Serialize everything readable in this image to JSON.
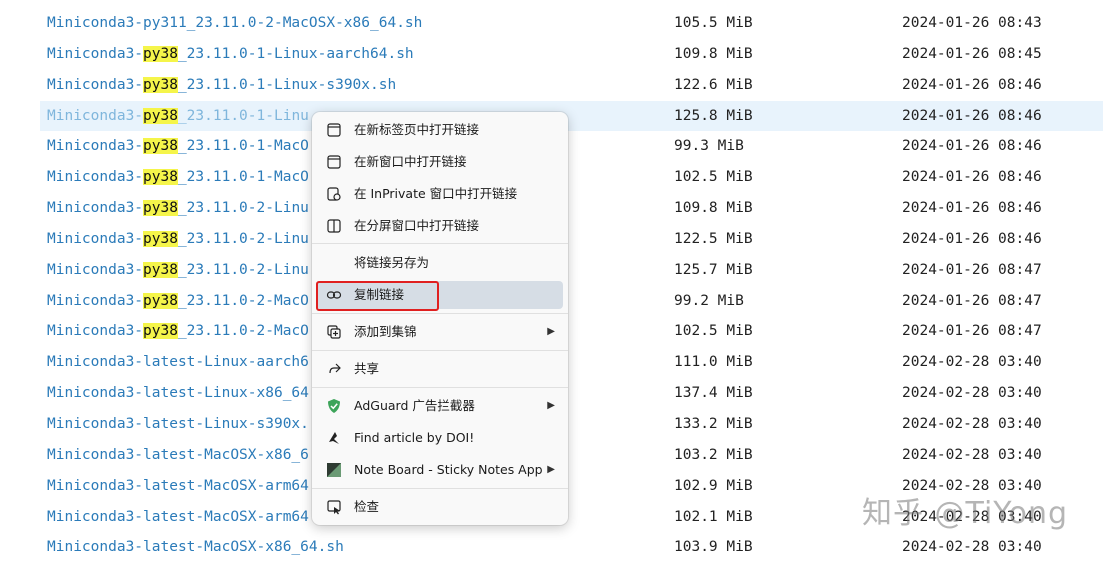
{
  "files": [
    {
      "pre": "Miniconda3-py311_23.11.0-2-MacOSX-x86_64.sh",
      "hl": "",
      "post": "",
      "size": "105.5 MiB",
      "date": "2024-01-26 08:43"
    },
    {
      "pre": "Miniconda3-",
      "hl": "py38",
      "post": "_23.11.0-1-Linux-aarch64.sh",
      "size": "109.8 MiB",
      "date": "2024-01-26 08:45"
    },
    {
      "pre": "Miniconda3-",
      "hl": "py38",
      "post": "_23.11.0-1-Linux-s390x.sh",
      "size": "122.6 MiB",
      "date": "2024-01-26 08:46"
    },
    {
      "pre": "Miniconda3-",
      "hl": "py38",
      "post": "_23.11.0-1-Linu",
      "size": "125.8 MiB",
      "date": "2024-01-26 08:46"
    },
    {
      "pre": "Miniconda3-",
      "hl": "py38",
      "post": "_23.11.0-1-MacO",
      "size": "99.3 MiB",
      "date": "2024-01-26 08:46"
    },
    {
      "pre": "Miniconda3-",
      "hl": "py38",
      "post": "_23.11.0-1-MacO",
      "size": "102.5 MiB",
      "date": "2024-01-26 08:46"
    },
    {
      "pre": "Miniconda3-",
      "hl": "py38",
      "post": "_23.11.0-2-Linu",
      "size": "109.8 MiB",
      "date": "2024-01-26 08:46"
    },
    {
      "pre": "Miniconda3-",
      "hl": "py38",
      "post": "_23.11.0-2-Linu",
      "size": "122.5 MiB",
      "date": "2024-01-26 08:46"
    },
    {
      "pre": "Miniconda3-",
      "hl": "py38",
      "post": "_23.11.0-2-Linu",
      "size": "125.7 MiB",
      "date": "2024-01-26 08:47"
    },
    {
      "pre": "Miniconda3-",
      "hl": "py38",
      "post": "_23.11.0-2-MacO",
      "size": "99.2 MiB",
      "date": "2024-01-26 08:47"
    },
    {
      "pre": "Miniconda3-",
      "hl": "py38",
      "post": "_23.11.0-2-MacO",
      "size": "102.5 MiB",
      "date": "2024-01-26 08:47"
    },
    {
      "pre": "Miniconda3-latest-Linux-aarch6",
      "hl": "",
      "post": "",
      "size": "111.0 MiB",
      "date": "2024-02-28 03:40"
    },
    {
      "pre": "Miniconda3-latest-Linux-x86_64",
      "hl": "",
      "post": "",
      "size": "137.4 MiB",
      "date": "2024-02-28 03:40"
    },
    {
      "pre": "Miniconda3-latest-Linux-s390x.",
      "hl": "",
      "post": "",
      "size": "133.2 MiB",
      "date": "2024-02-28 03:40"
    },
    {
      "pre": "Miniconda3-latest-MacOSX-x86_6",
      "hl": "",
      "post": "",
      "size": "103.2 MiB",
      "date": "2024-02-28 03:40"
    },
    {
      "pre": "Miniconda3-latest-MacOSX-arm64",
      "hl": "",
      "post": "",
      "size": "102.9 MiB",
      "date": "2024-02-28 03:40"
    },
    {
      "pre": "Miniconda3-latest-MacOSX-arm64",
      "hl": "",
      "post": "",
      "size": "102.1 MiB",
      "date": "2024-02-28 03:40"
    },
    {
      "pre": "Miniconda3-latest-MacOSX-x86_64.sh",
      "hl": "",
      "post": "",
      "size": "103.9 MiB",
      "date": "2024-02-28 03:40"
    }
  ],
  "menu": {
    "open_new_tab": "在新标签页中打开链接",
    "open_new_window": "在新窗口中打开链接",
    "open_inprivate": "在 InPrivate 窗口中打开链接",
    "open_split": "在分屏窗口中打开链接",
    "save_link_as": "将链接另存为",
    "copy_link": "复制链接",
    "add_to_collections": "添加到集锦",
    "share": "共享",
    "adguard": "AdGuard 广告拦截器",
    "find_doi": "Find article by DOI!",
    "note_board": "Note Board - Sticky Notes App",
    "inspect": "检查"
  },
  "watermark": "知乎 @TiYong",
  "colors": {
    "link": "#2b7bb9",
    "highlight": "#f5f54a",
    "hover_row": "#e8f3fc",
    "menu_active": "#d6dde5",
    "annotation_box": "#e02020"
  }
}
